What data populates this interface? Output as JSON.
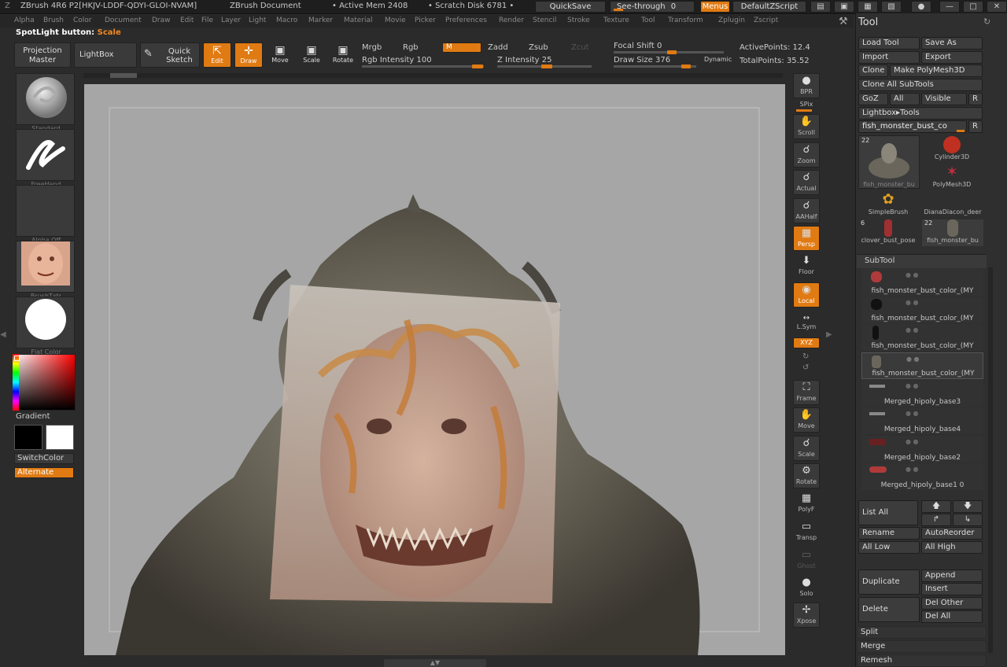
{
  "titlebar": {
    "app": "ZBrush 4R6 P2[HKJV-LDDF-QDYI-GLOI-NVAM]",
    "document": "ZBrush Document",
    "active_mem": "• Active Mem 2408",
    "scratch_disk": "• Scratch Disk 6781 •",
    "quicksave": "QuickSave",
    "see_through": "See-through",
    "see_through_value": "0",
    "menus": "Menus",
    "default_zscript": "DefaultZScript"
  },
  "menubar": [
    "Alpha",
    "Brush",
    "Color",
    "Document",
    "Draw",
    "Edit",
    "File",
    "Layer",
    "Light",
    "Macro",
    "Marker",
    "Material",
    "Movie",
    "Picker",
    "Preferences",
    "Render",
    "Stencil",
    "Stroke",
    "Texture",
    "Tool",
    "Transform",
    "Zplugin",
    "Zscript"
  ],
  "spotlight": {
    "label": "SpotLight button:",
    "value": "Scale"
  },
  "toolbar": {
    "projection_master": "Projection Master",
    "lightbox": "LightBox",
    "quick_sketch": "Quick Sketch",
    "edit": "Edit",
    "draw": "Draw",
    "move": "Move",
    "scale": "Scale",
    "rotate": "Rotate",
    "mrgb": "Mrgb",
    "rgb": "Rgb",
    "m": "M",
    "zadd": "Zadd",
    "zsub": "Zsub",
    "zcut": "Zcut",
    "rgb_intensity": "Rgb Intensity 100",
    "z_intensity": "Z Intensity 25",
    "focal_shift": "Focal Shift 0",
    "draw_size": "Draw Size 376",
    "dynamic": "Dynamic",
    "active_points": "ActivePoints: 12.4",
    "total_points": "TotalPoints: 35.52",
    "rgb_intensity_value": 100,
    "z_intensity_value": 25
  },
  "leftshelf": {
    "brush": "Standard",
    "stroke": "FreeHand",
    "alpha": "Alpha Off",
    "texture": "BrushTxtr",
    "material": "Flat Color",
    "gradient": "Gradient",
    "switch_color": "SwitchColor",
    "alternate": "Alternate"
  },
  "rightshelf": [
    {
      "label": "BPR",
      "icon": "bpr-icon",
      "active": false
    },
    {
      "label": "SPix",
      "icon": "spix-icon",
      "active": false
    },
    {
      "label": "Scroll",
      "icon": "scroll-icon",
      "active": false
    },
    {
      "label": "Zoom",
      "icon": "zoom-icon",
      "active": false
    },
    {
      "label": "Actual",
      "icon": "actual-icon",
      "active": false
    },
    {
      "label": "AAHalf",
      "icon": "aahalf-icon",
      "active": false
    },
    {
      "label": "Persp",
      "icon": "persp-icon",
      "active": true
    },
    {
      "label": "Floor",
      "icon": "floor-icon",
      "active": false
    },
    {
      "label": "Local",
      "icon": "local-icon",
      "active": true
    },
    {
      "label": "L.Sym",
      "icon": "lsym-icon",
      "active": false
    },
    {
      "label": "XYZ",
      "icon": "xyz-icon",
      "active": true
    },
    {
      "label": "Frame",
      "icon": "frame-icon",
      "active": false
    },
    {
      "label": "Move",
      "icon": "move-icon",
      "active": false
    },
    {
      "label": "Scale",
      "icon": "scale-icon",
      "active": false
    },
    {
      "label": "Rotate",
      "icon": "rotate-icon",
      "active": false
    },
    {
      "label": "PolyF",
      "icon": "polyf-icon",
      "active": false
    },
    {
      "label": "Transp",
      "icon": "transp-icon",
      "active": false
    },
    {
      "label": "Ghost",
      "icon": "ghost-icon",
      "active": false
    },
    {
      "label": "Solo",
      "icon": "solo-icon",
      "active": false
    },
    {
      "label": "Xpose",
      "icon": "xpose-icon",
      "active": false
    }
  ],
  "toolpanel": {
    "title": "Tool",
    "load_tool": "Load Tool",
    "save_as": "Save As",
    "import": "Import",
    "export": "Export",
    "clone": "Clone",
    "make_polymesh": "Make PolyMesh3D",
    "clone_all": "Clone All SubTools",
    "goz": "GoZ",
    "all": "All",
    "visible": "Visible",
    "r": "R",
    "lightbox_tools": "Lightbox▸Tools",
    "current_tool": "fish_monster_bust_co",
    "tools": [
      {
        "name": "fish_monster_bu",
        "count": "22"
      },
      {
        "name": "Cylinder3D",
        "count": ""
      },
      {
        "name": "PolyMesh3D",
        "count": ""
      },
      {
        "name": "SimpleBrush",
        "count": ""
      },
      {
        "name": "DianaDiacon_deer",
        "count": ""
      },
      {
        "name": "clover_bust_pose",
        "count": "6"
      },
      {
        "name": "fish_monster_bu",
        "count": "22"
      }
    ],
    "subtool_title": "SubTool",
    "subtools": [
      "fish_monster_bust_color_(MY",
      "fish_monster_bust_color_(MY",
      "fish_monster_bust_color_(MY",
      "fish_monster_bust_color_(MY",
      "Merged_hipoly_base3",
      "Merged_hipoly_base4",
      "Merged_hipoly_base2",
      "Merged_hipoly_base1 0"
    ],
    "list_all": "List All",
    "rename": "Rename",
    "auto_reorder": "AutoReorder",
    "all_low": "All Low",
    "all_high": "All High",
    "duplicate": "Duplicate",
    "append": "Append",
    "insert": "Insert",
    "delete": "Delete",
    "del_other": "Del Other",
    "del_all": "Del All",
    "split": "Split",
    "merge": "Merge",
    "remesh": "Remesh"
  },
  "colors": {
    "accent": "#e07a12",
    "panel": "#2f2f2f",
    "canvas": "#a6a6a6"
  }
}
